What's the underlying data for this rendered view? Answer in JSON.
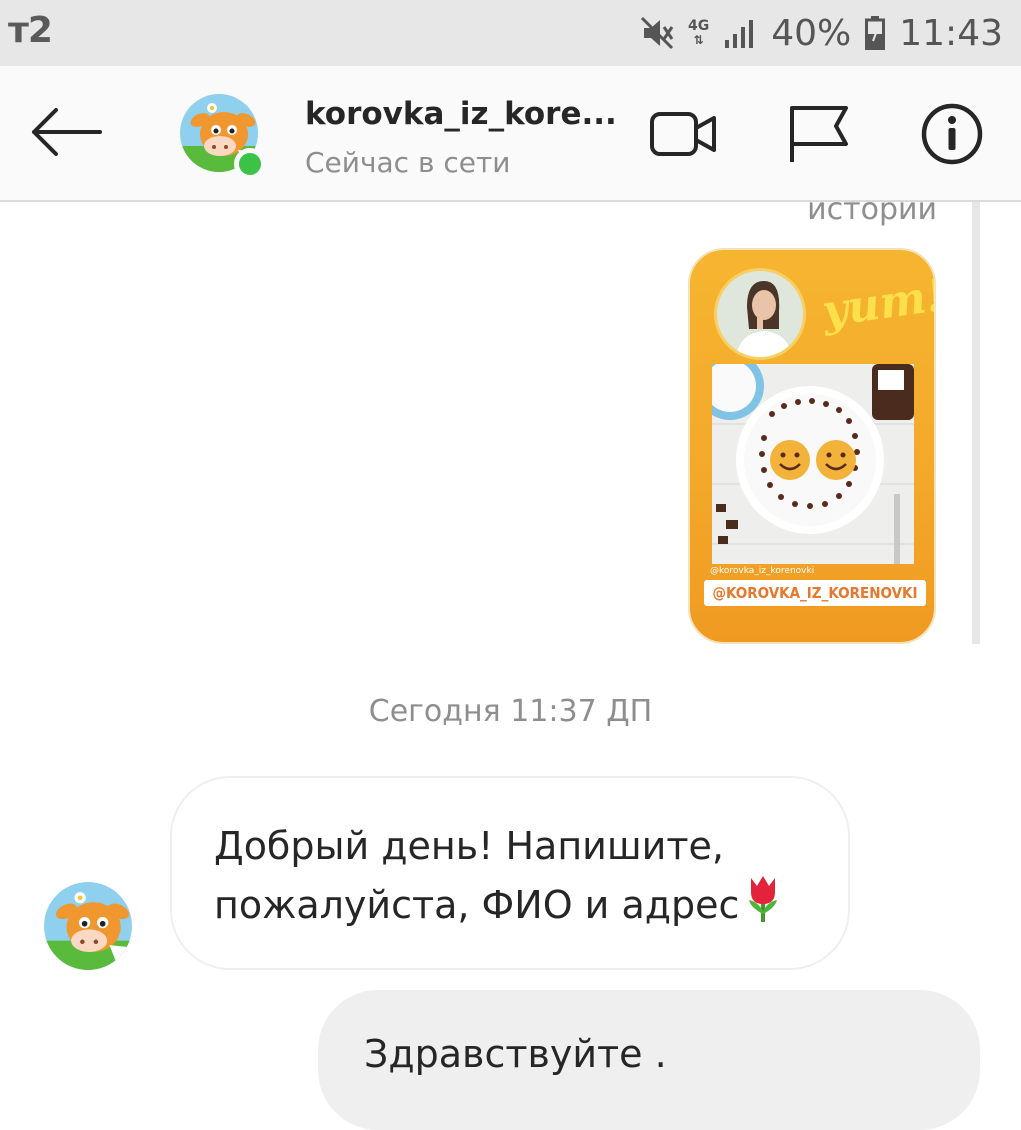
{
  "status_bar": {
    "carrier": "т2",
    "network": "4G",
    "battery": "40%",
    "time": "11:43",
    "icons": [
      "mute-icon",
      "network-4g-icon",
      "signal-icon",
      "battery-icon"
    ]
  },
  "header": {
    "username": "korovka_iz_kore...",
    "status": "Сейчас в сети",
    "actions": [
      "back-arrow-icon",
      "video-call-icon",
      "flag-icon",
      "info-icon"
    ],
    "online_color": "#3bc247"
  },
  "chat": {
    "story_caption": "истории",
    "story": {
      "sticker_text": "yum!",
      "handle_small": "@korovka_iz_korenovki",
      "mention_tag": "@KOROVKA_IZ_KORENOVKI",
      "accent": "#f3a82a"
    },
    "date_divider": "Сегодня 11:37 ДП",
    "messages": [
      {
        "direction": "incoming",
        "text": "Добрый день! Напишите, пожалуйста, ФИО и адрес",
        "emoji": "tulip-emoji"
      },
      {
        "direction": "outgoing",
        "text": "Здравствуйте ."
      }
    ]
  }
}
